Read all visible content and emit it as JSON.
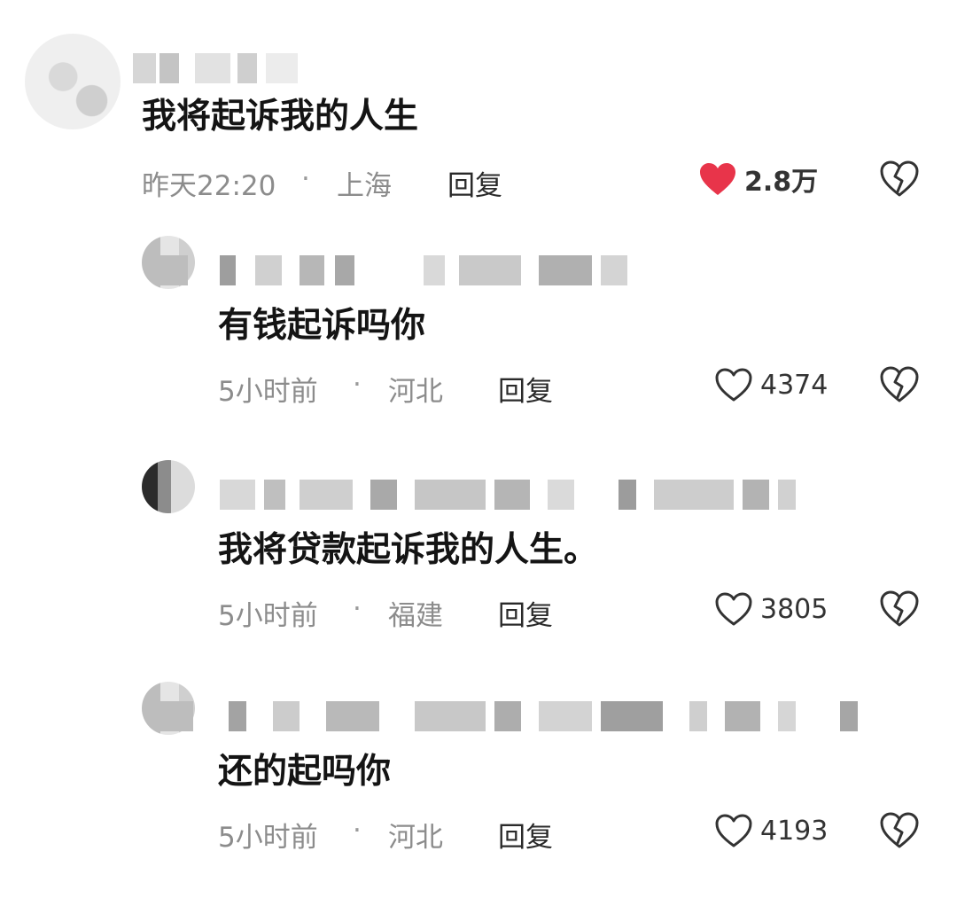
{
  "colors": {
    "liked_heart": "#e8344a",
    "icon_stroke": "#333333",
    "meta_text": "#8c8c8c"
  },
  "comments": [
    {
      "text": "我将起诉我的人生",
      "time": "昨天22:20",
      "separator": "·",
      "location": "上海",
      "reply_label": "回复",
      "likes": "2.8万",
      "liked": true,
      "like_icon": "heart-filled-icon",
      "dislike_icon": "broken-heart-icon"
    },
    {
      "text": "有钱起诉吗你",
      "time": "5小时前",
      "separator": "·",
      "location": "河北",
      "reply_label": "回复",
      "likes": "4374",
      "liked": false,
      "like_icon": "heart-outline-icon",
      "dislike_icon": "broken-heart-icon"
    },
    {
      "text": "我将贷款起诉我的人生。",
      "time": "5小时前",
      "separator": "·",
      "location": "福建",
      "reply_label": "回复",
      "likes": "3805",
      "liked": false,
      "like_icon": "heart-outline-icon",
      "dislike_icon": "broken-heart-icon"
    },
    {
      "text": "还的起吗你",
      "time": "5小时前",
      "separator": "·",
      "location": "河北",
      "reply_label": "回复",
      "likes": "4193",
      "liked": false,
      "like_icon": "heart-outline-icon",
      "dislike_icon": "broken-heart-icon"
    }
  ]
}
